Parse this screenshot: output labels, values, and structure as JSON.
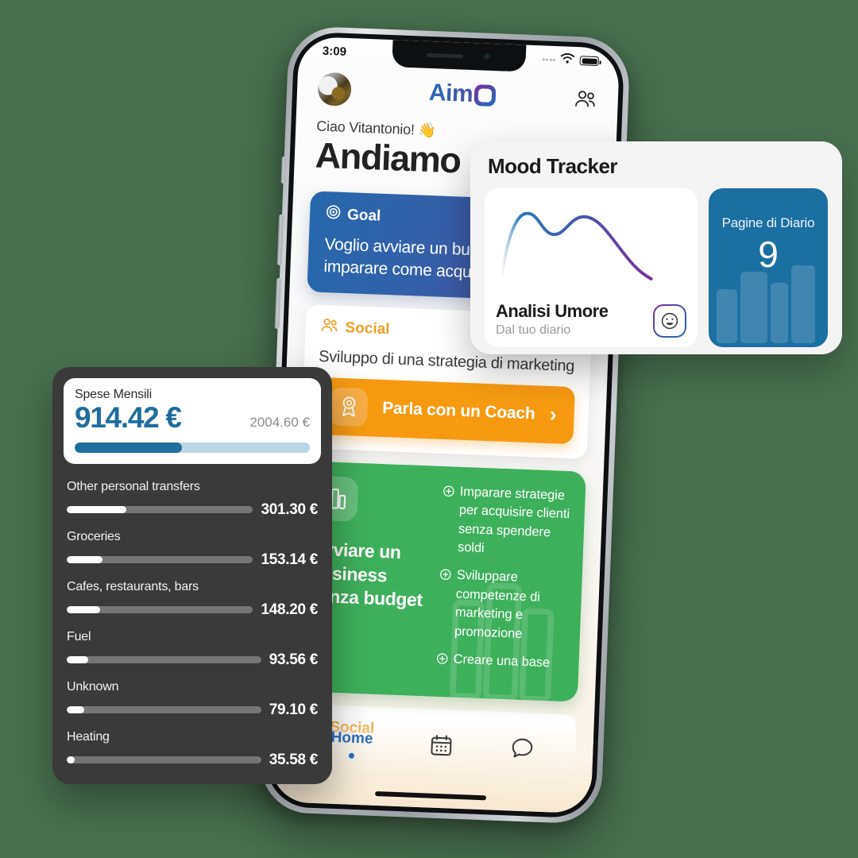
{
  "background_color": "#4a7050",
  "phone": {
    "status_bar": {
      "time": "3:09",
      "wifi_icon": "wifi-icon",
      "battery_icon": "battery-icon",
      "signal_icon": "signal-dots-icon"
    },
    "header": {
      "avatar": "user-avatar",
      "logo_text": "Aim",
      "logo_mark": "aim-logo-mark",
      "contacts_icon": "people-icon"
    },
    "greeting": {
      "small": "Ciao Vitantonio! 👋",
      "big": "Andiamo"
    },
    "goal_card": {
      "label": "Goal",
      "icon": "target-icon",
      "text": "Voglio avviare un business e imparare come acquisire clienti",
      "gradient_from": "#2668ab",
      "gradient_to": "#5a4a9c"
    },
    "social_card": {
      "label": "Social",
      "icon": "people-icon",
      "title": "Sviluppo di una strategia di marketing",
      "button_label": "Parla con un Coach",
      "button_icon": "medal-icon",
      "chevron": "›",
      "accent_color": "#f79a12"
    },
    "green_card": {
      "title": "Avviare un business senza budget",
      "icon": "books-icon",
      "color": "#3fb05a",
      "bullets": [
        "Imparare strategie per acquisire clienti senza spendere soldi",
        "Sviluppare competenze di marketing e promozione",
        "Creare una base"
      ]
    },
    "social_card_2": {
      "label": "Social",
      "icon": "people-icon"
    },
    "tabbar": {
      "items": [
        {
          "label": "Home",
          "icon": "home-label",
          "active": true
        },
        {
          "label": "",
          "icon": "calendar-icon",
          "active": false
        },
        {
          "label": "",
          "icon": "chat-bubble-icon",
          "active": false
        }
      ],
      "active_color": "#2f6fc4"
    }
  },
  "mood_tracker": {
    "title": "Mood Tracker",
    "card_bg": "#f4f4f4",
    "analysis": {
      "heading": "Analisi Umore",
      "subtitle": "Dal tuo diario",
      "emoji_icon": "smiley-face-icon"
    },
    "diary_tile": {
      "label": "Pagine di Diario",
      "value": "9",
      "color": "#1c6fa1",
      "decoration_icon": "books-shelf-icon"
    },
    "chart_data": {
      "type": "line",
      "title": "Mood Tracker",
      "x": [
        0,
        1,
        2,
        3,
        4,
        5,
        6,
        7
      ],
      "values": [
        0.08,
        0.72,
        0.9,
        0.7,
        0.78,
        0.88,
        0.62,
        0.22
      ],
      "line_gradient": [
        "#2b7ab8",
        "#7b2f9e"
      ],
      "grid": false,
      "legend": "none",
      "xlabel": "",
      "ylabel": ""
    }
  },
  "expenses": {
    "panel_bg": "#3a3a3a",
    "summary": {
      "label": "Spese Mensili",
      "amount": "914.42 €",
      "total": "2004.60 €",
      "progress_percent": 45.6,
      "accent_color": "#1f6e9e",
      "track_color": "#bcd6e5"
    },
    "rows": [
      {
        "name": "Other personal transfers",
        "value": "301.30 €",
        "percent": 32
      },
      {
        "name": "Groceries",
        "value": "153.14 €",
        "percent": 19
      },
      {
        "name": "Cafes, restaurants, bars",
        "value": "148.20 €",
        "percent": 18
      },
      {
        "name": "Fuel",
        "value": "93.56 €",
        "percent": 11
      },
      {
        "name": "Unknown",
        "value": "79.10 €",
        "percent": 9
      },
      {
        "name": "Heating",
        "value": "35.58 €",
        "percent": 4
      }
    ]
  }
}
